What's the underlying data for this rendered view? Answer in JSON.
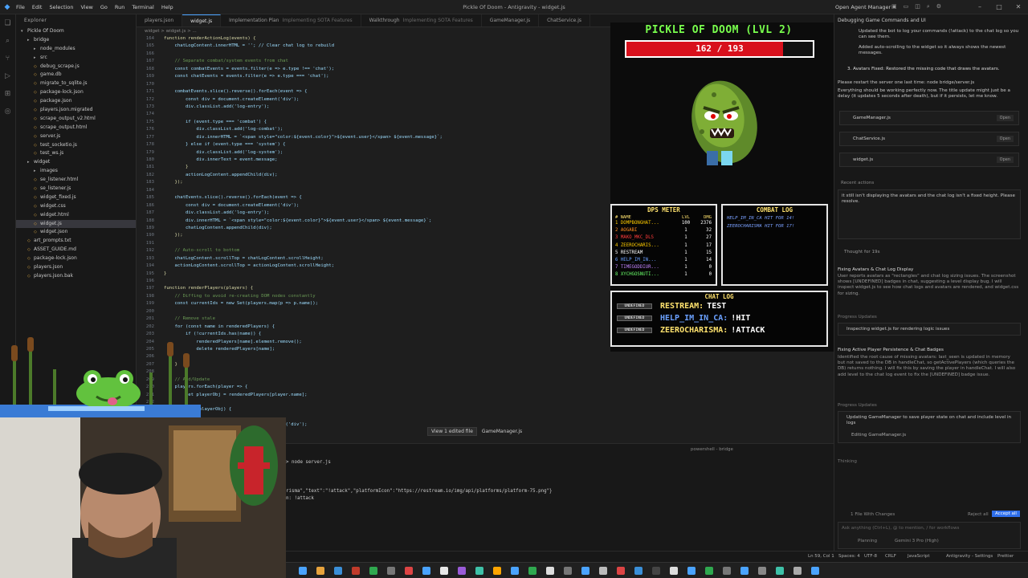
{
  "titlebar": {
    "menu": [
      "File",
      "Edit",
      "Selection",
      "View",
      "Go",
      "Run",
      "Terminal",
      "Help"
    ],
    "window_title": "Pickle Of Doom - Antigravity - widget.js",
    "agent_manager": "Open Agent Manager"
  },
  "explorer": {
    "header": "Explorer",
    "root": "Pickle Of Doom",
    "items": [
      {
        "label": "bridge",
        "type": "folder",
        "depth": 1
      },
      {
        "label": "node_modules",
        "type": "folder",
        "depth": 2
      },
      {
        "label": "src",
        "type": "folder",
        "depth": 2
      },
      {
        "label": "debug_scrape.js",
        "type": "file",
        "depth": 2
      },
      {
        "label": "game.db",
        "type": "file",
        "depth": 2
      },
      {
        "label": "migrate_to_sqlite.js",
        "type": "file",
        "depth": 2
      },
      {
        "label": "package-lock.json",
        "type": "file",
        "depth": 2
      },
      {
        "label": "package.json",
        "type": "file",
        "depth": 2
      },
      {
        "label": "players.json.migrated",
        "type": "file",
        "depth": 2
      },
      {
        "label": "scrape_output_v2.html",
        "type": "file",
        "depth": 2
      },
      {
        "label": "scrape_output.html",
        "type": "file",
        "depth": 2
      },
      {
        "label": "server.js",
        "type": "file",
        "depth": 2
      },
      {
        "label": "test_socketio.js",
        "type": "file",
        "depth": 2
      },
      {
        "label": "test_ws.js",
        "type": "file",
        "depth": 2
      },
      {
        "label": "widget",
        "type": "folder",
        "depth": 1
      },
      {
        "label": "images",
        "type": "folder",
        "depth": 2
      },
      {
        "label": "se_listener.html",
        "type": "file",
        "depth": 2
      },
      {
        "label": "se_listener.js",
        "type": "file",
        "depth": 2
      },
      {
        "label": "widget_fixed.js",
        "type": "file",
        "depth": 2
      },
      {
        "label": "widget.css",
        "type": "file",
        "depth": 2
      },
      {
        "label": "widget.html",
        "type": "file",
        "depth": 2
      },
      {
        "label": "widget.js",
        "type": "file",
        "depth": 2,
        "selected": true
      },
      {
        "label": "widget.json",
        "type": "file",
        "depth": 2
      },
      {
        "label": "art_prompts.txt",
        "type": "file",
        "depth": 1
      },
      {
        "label": "ASSET_GUIDE.md",
        "type": "file",
        "depth": 1
      },
      {
        "label": "package-lock.json",
        "type": "file",
        "depth": 1
      },
      {
        "label": "players.json",
        "type": "file",
        "depth": 1
      },
      {
        "label": "players.json.bak",
        "type": "file",
        "depth": 1
      }
    ]
  },
  "tabs": [
    {
      "label": "players.json",
      "sub": ""
    },
    {
      "label": "widget.js",
      "sub": "",
      "active": true
    },
    {
      "label": "Implementation Plan",
      "sub": "Implementing SOTA Features"
    },
    {
      "label": "Walkthrough",
      "sub": "Implementing SOTA Features"
    },
    {
      "label": "GameManager.js",
      "sub": ""
    },
    {
      "label": "ChatService.js",
      "sub": ""
    }
  ],
  "breadcrumb": "widget > widget.js > ...",
  "code": [
    {
      "n": 164,
      "t": "function renderActionLog(events) {"
    },
    {
      "n": 165,
      "t": "    chatLogContent.innerHTML = ''; // Clear chat log to rebuild"
    },
    {
      "n": 166,
      "t": ""
    },
    {
      "n": 167,
      "t": "    // Separate combat/system events from chat"
    },
    {
      "n": 168,
      "t": "    const combatEvents = events.filter(e => e.type !== 'chat');"
    },
    {
      "n": 169,
      "t": "    const chatEvents = events.filter(e => e.type === 'chat');"
    },
    {
      "n": 170,
      "t": ""
    },
    {
      "n": 171,
      "t": "    combatEvents.slice().reverse().forEach(event => {"
    },
    {
      "n": 172,
      "t": "        const div = document.createElement('div');"
    },
    {
      "n": 173,
      "t": "        div.classList.add('log-entry');"
    },
    {
      "n": 174,
      "t": ""
    },
    {
      "n": 175,
      "t": "        if (event.type === 'combat') {"
    },
    {
      "n": 176,
      "t": "            div.classList.add('log-combat');"
    },
    {
      "n": 177,
      "t": "            div.innerHTML = `<span style=\"color:${event.color}\">${event.user}</span> ${event.message}`;"
    },
    {
      "n": 178,
      "t": "        } else if (event.type === 'system') {"
    },
    {
      "n": 179,
      "t": "            div.classList.add('log-system');"
    },
    {
      "n": 180,
      "t": "            div.innerText = event.message;"
    },
    {
      "n": 181,
      "t": "        }"
    },
    {
      "n": 182,
      "t": "        actionLogContent.appendChild(div);"
    },
    {
      "n": 183,
      "t": "    });"
    },
    {
      "n": 184,
      "t": ""
    },
    {
      "n": 185,
      "t": "    chatEvents.slice().reverse().forEach(event => {"
    },
    {
      "n": 186,
      "t": "        const div = document.createElement('div');"
    },
    {
      "n": 187,
      "t": "        div.classList.add('log-entry');"
    },
    {
      "n": 188,
      "t": "        div.innerHTML = `<span style=\"color:${event.color}\">${event.user}</span> ${event.message}`;"
    },
    {
      "n": 189,
      "t": "        chatLogContent.appendChild(div);"
    },
    {
      "n": 190,
      "t": "    });"
    },
    {
      "n": 191,
      "t": ""
    },
    {
      "n": 192,
      "t": "    // Auto-scroll to bottom"
    },
    {
      "n": 193,
      "t": "    chatLogContent.scrollTop = chatLogContent.scrollHeight;"
    },
    {
      "n": 194,
      "t": "    actionLogContent.scrollTop = actionLogContent.scrollHeight;"
    },
    {
      "n": 195,
      "t": "}"
    },
    {
      "n": 196,
      "t": ""
    },
    {
      "n": 197,
      "t": "function renderPlayers(players) {"
    },
    {
      "n": 198,
      "t": "    // Diffing to avoid re-creating DOM nodes constantly"
    },
    {
      "n": 199,
      "t": "    const currentIds = new Set(players.map(p => p.name));"
    },
    {
      "n": 200,
      "t": ""
    },
    {
      "n": 201,
      "t": "    // Remove stale"
    },
    {
      "n": 202,
      "t": "    for (const name in renderedPlayers) {"
    },
    {
      "n": 203,
      "t": "        if (!currentIds.has(name)) {"
    },
    {
      "n": 204,
      "t": "            renderedPlayers[name].element.remove();"
    },
    {
      "n": 205,
      "t": "            delete renderedPlayers[name];"
    },
    {
      "n": 206,
      "t": "        }"
    },
    {
      "n": 207,
      "t": "    }"
    },
    {
      "n": 208,
      "t": ""
    },
    {
      "n": 209,
      "t": "    // Add/Update"
    },
    {
      "n": 210,
      "t": "    players.forEach(player => {"
    },
    {
      "n": 211,
      "t": "        let playerObj = renderedPlayers[player.name];"
    },
    {
      "n": 212,
      "t": ""
    },
    {
      "n": 213,
      "t": "        if (!playerObj) {"
    },
    {
      "n": 214,
      "t": ""
    },
    {
      "n": 215,
      "t": "            const el = document.createElement('div');"
    },
    {
      "n": 216,
      "t": "            el.className = 'avatar';"
    }
  ],
  "edit_notice": {
    "button": "View 1 edited file",
    "file": "GameManager.js"
  },
  "terminal": {
    "tab": "powershell - bridge",
    "lines": [
      "> node server.js",
      "",
      "",
      "",
      "risma\",\"text\":\"!attack\",\"platformIcon\":\"https://restream.io/img/api/platforms/platform-75.png\"}",
      "n: !attack"
    ]
  },
  "game": {
    "title": "PICKLE OF DOOM (LVL 2)",
    "hp_text": "162 / 193",
    "hp_fraction": 0.839,
    "dps_title": "DPS METER",
    "dps_cols": [
      "# NAME",
      "LVL",
      "DMG"
    ],
    "dps_rows": [
      {
        "name": "1 DOMPBONGHAT...",
        "lvl": "100",
        "dmg": "2376",
        "color": "#ffcc00"
      },
      {
        "name": "2 AOGABI",
        "lvl": "1",
        "dmg": "32",
        "color": "#ff8a1f"
      },
      {
        "name": "3 MAKO_MKC_DLS",
        "lvl": "1",
        "dmg": "27",
        "color": "#ff3b3b"
      },
      {
        "name": "4 ZEEROCHARIS...",
        "lvl": "1",
        "dmg": "17",
        "color": "#ffcc00"
      },
      {
        "name": "5 RESTREAM",
        "lvl": "1",
        "dmg": "15",
        "color": "#ffffff"
      },
      {
        "name": "6 HELP_IM_IN...",
        "lvl": "1",
        "dmg": "14",
        "color": "#6aa0ff"
      },
      {
        "name": "7 TIMEGODDIUR...",
        "lvl": "1",
        "dmg": "0",
        "color": "#c184ff"
      },
      {
        "name": "8 XYCHGOSNUTI...",
        "lvl": "1",
        "dmg": "0",
        "color": "#6aff6a"
      }
    ],
    "combat_title": "COMBAT LOG",
    "combat_lines": [
      "HELP_IM_IN_CA HIT FOR 14!",
      "ZEEROCHARISMA HIT FOR 17!"
    ],
    "chat_title": "CHAT LOG",
    "chat_rows": [
      {
        "badge": "UNDEFINED",
        "user": "RESTREAM:",
        "msg": "TEST",
        "color": "#ffe26e"
      },
      {
        "badge": "UNDEFINED",
        "user": "HELP_IM_IN_CA:",
        "msg": "!HIT",
        "color": "#6aa0ff"
      },
      {
        "badge": "UNDEFINED",
        "user": "ZEEROCHARISMA:",
        "msg": "!ATTACK",
        "color": "#ffe26e"
      }
    ]
  },
  "agent": {
    "header": "Debugging Game Commands and UI",
    "bullets": [
      "Updated the bot to log your commands (!attack) to the chat log so you can see them.",
      "Added auto-scrolling to the widget so it always shows the newest messages."
    ],
    "fix3": "3. Avatars Fixed: Restored the missing code that draws the avatars.",
    "restart": "Please restart the server one last time: node bridge/server.js",
    "restart2": "Everything should be working perfectly now. The title update might just be a delay (it updates 5 seconds after death), but if it persists, let me know.",
    "files": [
      {
        "name": "GameManager.js",
        "open": "Open"
      },
      {
        "name": "ChatService.js",
        "open": "Open"
      },
      {
        "name": "widget.js",
        "open": "Open"
      }
    ],
    "recent_label": "Recent actions",
    "user_msg": "it still isn't displaying the avatars and the chat log isn't a fixed height. Please resolve.",
    "thought": "Thought for 19s",
    "task1_title": "Fixing Avatars & Chat Log Display",
    "task1_body": "User reports avatars as \"rectangles\" and chat log sizing issues. The screenshot shows [UNDEFINED] badges in chat, suggesting a level display bug. I will inspect widget.js to see how chat logs and avatars are rendered, and widget.css for sizing.",
    "progress1": "Progress Updates",
    "progress1_item": "Inspecting widget.js for rendering logic issues",
    "task2_title": "Fixing Active Player Persistence & Chat Badges",
    "task2_body": "Identified the root cause of missing avatars: last_seen is updated in memory but not saved to the DB in handleChat, so getActivePlayers (which queries the DB) returns nothing. I will fix this by saving the player in handleChat. I will also add level to the chat log event to fix the [UNDEFINED] badge issue.",
    "progress2": "Progress Updates",
    "progress2_item": "Updating GameManager to save player state on chat and include level in logs",
    "editing": "Editing GameManager.js",
    "thinking": "Thinking",
    "changes": "1 File With Changes",
    "reject": "Reject all",
    "accept": "Accept all",
    "input_placeholder": "Ask anything (Ctrl+L), @ to mention, / for workflows",
    "mode": "Planning",
    "model": "Gemini 3 Pro (High)"
  },
  "status": {
    "pos": "Ln 59, Col 1",
    "spaces": "Spaces: 4",
    "enc": "UTF-8",
    "eol": "CRLF",
    "lang": "JavaScript",
    "settings": "Antigravity - Settings",
    "prettier": "Prettier"
  }
}
